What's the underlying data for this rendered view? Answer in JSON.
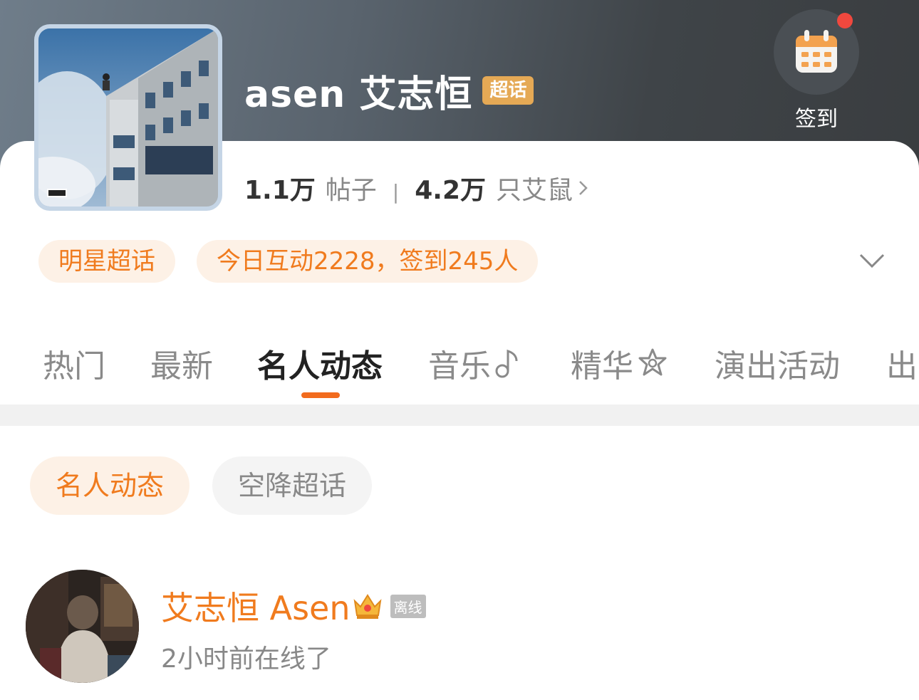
{
  "header": {
    "title": "asen 艾志恒",
    "badge": "超话",
    "checkin_label": "签到"
  },
  "stats": {
    "posts_value": "1.1万",
    "posts_label": "帖子",
    "fans_value": "4.2万",
    "fans_label": "只艾鼠"
  },
  "pills": {
    "category": "明星超话",
    "activity": "今日互动2228，签到245人"
  },
  "tabs": [
    {
      "label": "热门"
    },
    {
      "label": "最新"
    },
    {
      "label": "名人动态",
      "active": true
    },
    {
      "label": "音乐"
    },
    {
      "label": "精华"
    },
    {
      "label": "演出活动"
    },
    {
      "label": "出"
    }
  ],
  "subtabs": [
    {
      "label": "名人动态",
      "active": true
    },
    {
      "label": "空降超话"
    }
  ],
  "user": {
    "name": "艾志恒 Asen",
    "status_badge": "离线",
    "online_text": "2小时前在线了"
  },
  "colors": {
    "accent": "#f07b1e",
    "badge": "#e5a955",
    "notification_dot": "#f0483e"
  },
  "icons": [
    "calendar-icon",
    "chevron-right-icon",
    "chevron-down-icon",
    "music-note-icon",
    "star-badge-icon",
    "crown-icon"
  ]
}
